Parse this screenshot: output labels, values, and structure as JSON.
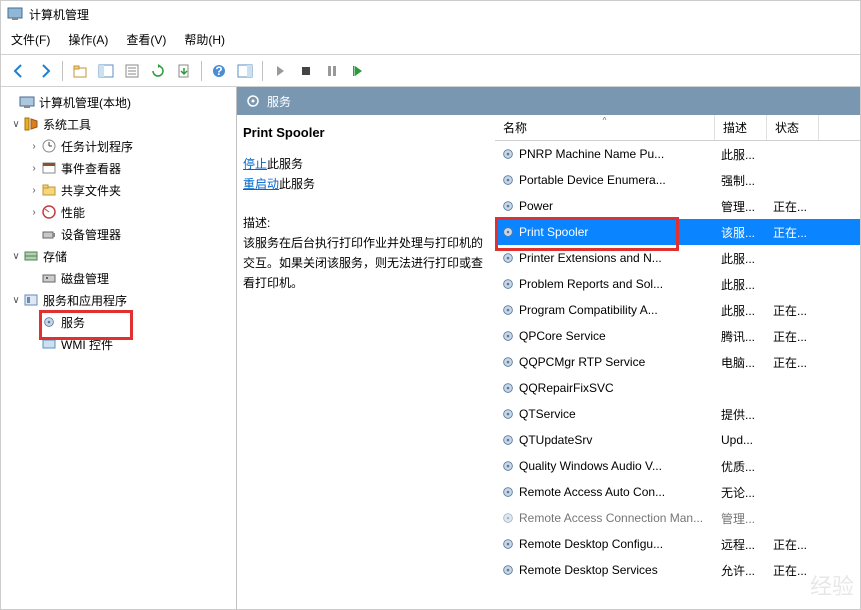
{
  "window": {
    "title": "计算机管理"
  },
  "menu": {
    "file": "文件(F)",
    "action": "操作(A)",
    "view": "查看(V)",
    "help": "帮助(H)"
  },
  "tree": {
    "root": "计算机管理(本地)",
    "system_tools": "系统工具",
    "task_scheduler": "任务计划程序",
    "event_viewer": "事件查看器",
    "shared_folders": "共享文件夹",
    "performance": "性能",
    "device_manager": "设备管理器",
    "storage": "存储",
    "disk_mgmt": "磁盘管理",
    "services_apps": "服务和应用程序",
    "services": "服务",
    "wmi": "WMI 控件"
  },
  "panel": {
    "header": "服务",
    "title": "Print Spooler",
    "stop": "停止",
    "stop_suffix": "此服务",
    "restart": "重启动",
    "restart_suffix": "此服务",
    "desc_label": "描述:",
    "desc": "该服务在后台执行打印作业并处理与打印机的交互。如果关闭该服务，则无法进行打印或查看打印机。"
  },
  "columns": {
    "name": "名称",
    "desc": "描述",
    "status": "状态"
  },
  "services": [
    {
      "name": "PNRP Machine Name Pu...",
      "desc": "此服...",
      "status": ""
    },
    {
      "name": "Portable Device Enumera...",
      "desc": "强制...",
      "status": ""
    },
    {
      "name": "Power",
      "desc": "管理...",
      "status": "正在..."
    },
    {
      "name": "Print Spooler",
      "desc": "该服...",
      "status": "正在...",
      "selected": true,
      "highlight": true
    },
    {
      "name": "Printer Extensions and N...",
      "desc": "此服...",
      "status": ""
    },
    {
      "name": "Problem Reports and Sol...",
      "desc": "此服...",
      "status": ""
    },
    {
      "name": "Program Compatibility A...",
      "desc": "此服...",
      "status": "正在..."
    },
    {
      "name": "QPCore Service",
      "desc": "腾讯...",
      "status": "正在..."
    },
    {
      "name": "QQPCMgr RTP Service",
      "desc": "电脑...",
      "status": "正在..."
    },
    {
      "name": "QQRepairFixSVC",
      "desc": "",
      "status": ""
    },
    {
      "name": "QTService",
      "desc": "提供...",
      "status": ""
    },
    {
      "name": "QTUpdateSrv",
      "desc": "Upd...",
      "status": ""
    },
    {
      "name": "Quality Windows Audio V...",
      "desc": "优质...",
      "status": ""
    },
    {
      "name": "Remote Access Auto Con...",
      "desc": "无论...",
      "status": ""
    },
    {
      "name": "Remote Access Connection Man...",
      "desc": "管理...",
      "status": "",
      "faded": true
    },
    {
      "name": "Remote Desktop Configu...",
      "desc": "远程...",
      "status": "正在..."
    },
    {
      "name": "Remote Desktop Services",
      "desc": "允许...",
      "status": "正在..."
    }
  ]
}
